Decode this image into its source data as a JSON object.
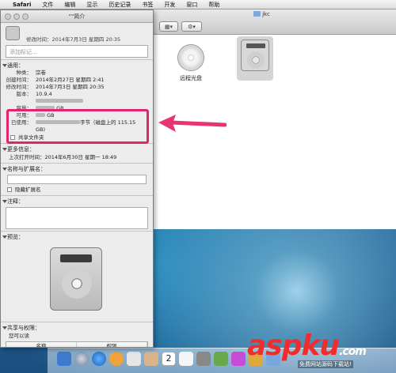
{
  "menubar": {
    "apple": "",
    "items": [
      "Safari",
      "文件",
      "编辑",
      "显示",
      "历史记录",
      "书签",
      "开发",
      "窗口",
      "帮助"
    ]
  },
  "finder": {
    "title": "jkc",
    "items": [
      {
        "label": "远程光盘"
      },
      {
        "label": ""
      }
    ]
  },
  "info": {
    "title": "\"\"简介",
    "name": "",
    "modified": "修改时间：2014年7月3日 星期四 20:35",
    "tags_placeholder": "添加标记...",
    "general": {
      "header": "通用：",
      "rows": [
        {
          "k": "种类：",
          "v": "宗卷"
        },
        {
          "k": "创建时间：",
          "v": "2014年2月27日 星期四 2:41"
        },
        {
          "k": "修改时间：",
          "v": "2014年7月3日 星期四 20:35"
        },
        {
          "k": "版本：",
          "v": "10.9.4"
        }
      ],
      "capacity": {
        "k": "容量：",
        "v": "GB"
      },
      "available": {
        "k": "可用：",
        "v": "GB"
      },
      "used": {
        "k": "已使用：",
        "v": "字节（磁盘上的 115.15"
      },
      "used_line2": "GB)",
      "shared_folder": "共享文件夹"
    },
    "more": {
      "header": "更多信息：",
      "last_opened": "上次打开时间：2014年6月30日 星期一 18:49"
    },
    "name_ext": {
      "header": "名称与扩展名：",
      "value": "",
      "hide_ext": "隐藏扩展名"
    },
    "comments": {
      "header": "注释："
    },
    "preview": {
      "header": "预览："
    },
    "sharing": {
      "header": "共享与权限：",
      "sub": "您可以读",
      "col_name": "名称",
      "col_priv": "权限"
    }
  },
  "watermark": {
    "brand": "aspku",
    "brand_suffix": ".com",
    "tagline": "免费网站源码下载站!"
  },
  "colors": {
    "highlight": "#e2246f",
    "arrow": "#e8356f",
    "watermark": "#ef2d2d"
  }
}
